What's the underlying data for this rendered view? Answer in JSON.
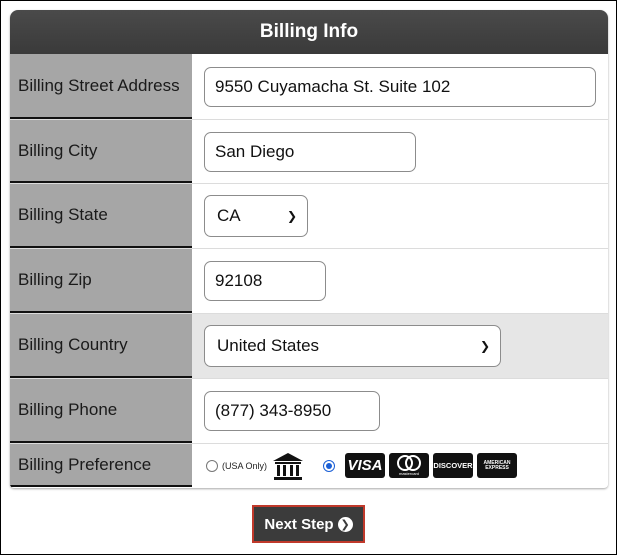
{
  "form": {
    "title": "Billing Info",
    "street": {
      "label": "Billing Street Address",
      "value": "9550 Cuyamacha St. Suite 102"
    },
    "city": {
      "label": "Billing City",
      "value": "San Diego"
    },
    "state": {
      "label": "Billing State",
      "value": "CA"
    },
    "zip": {
      "label": "Billing Zip",
      "value": "92108"
    },
    "country": {
      "label": "Billing Country",
      "value": "United States"
    },
    "phone": {
      "label": "Billing Phone",
      "value": "(877) 343-8950"
    },
    "preference": {
      "label": "Billing Preference",
      "bank_option_note": "(USA Only)",
      "selected": "card",
      "icons": [
        "bank-icon",
        "visa-icon",
        "mastercard-icon",
        "discover-icon",
        "american-express-icon"
      ],
      "card_labels": {
        "visa": "VISA",
        "mastercard": "mastercard",
        "discover": "DISCOVER",
        "amex": "AMERICAN EXPRESS"
      }
    }
  },
  "actions": {
    "next_label": "Next Step"
  },
  "colors": {
    "header": "#3f3f3f",
    "label_bg": "#a6a6a6",
    "button_border": "#c0392b"
  }
}
